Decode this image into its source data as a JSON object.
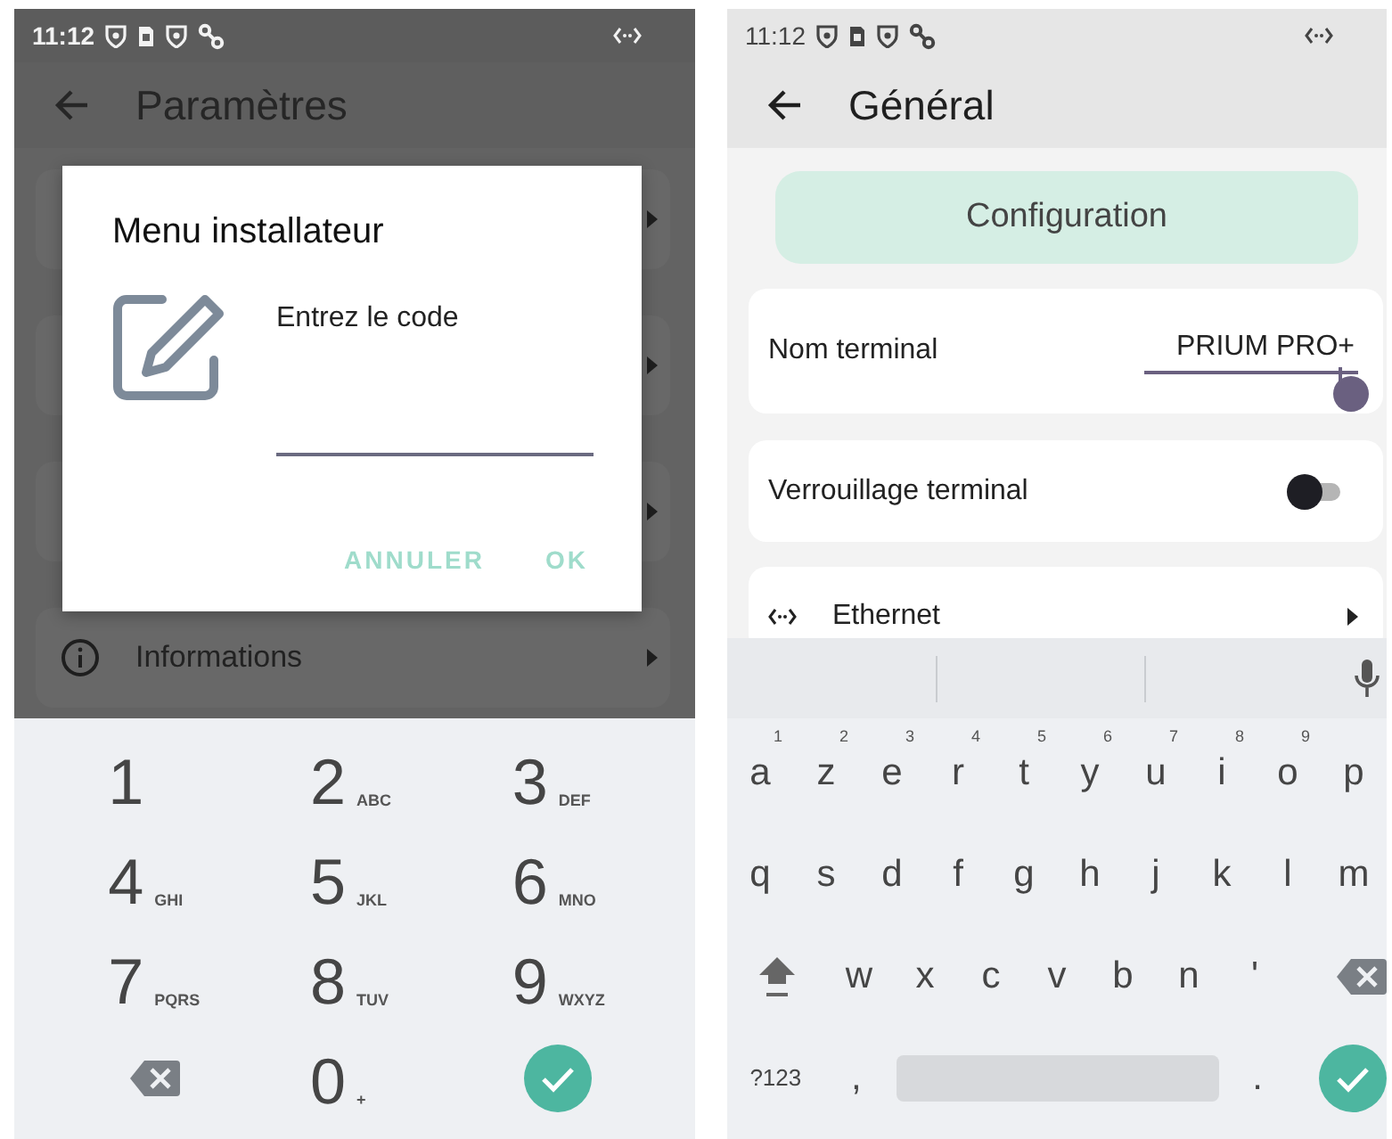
{
  "left_phone": {
    "status_bar": {
      "time": "11:12"
    },
    "app_bar": {
      "title": "Paramètres"
    },
    "list": [
      {
        "kind": "covered"
      },
      {
        "kind": "covered"
      },
      {
        "kind": "covered"
      },
      {
        "kind": "row",
        "label": "Informations"
      }
    ],
    "dialog": {
      "title": "Menu installateur",
      "label": "Entrez le code",
      "buttons": [
        "ANNULER",
        "OK"
      ]
    },
    "keypad": [
      {
        "kind": "digit",
        "digit": "1"
      },
      {
        "kind": "digit",
        "digit": "2",
        "letters": "ABC"
      },
      {
        "kind": "digit",
        "digit": "3",
        "letters": "DEF"
      },
      {
        "kind": "digit",
        "digit": "4",
        "letters": "GHI"
      },
      {
        "kind": "digit",
        "digit": "5",
        "letters": "JKL"
      },
      {
        "kind": "digit",
        "digit": "6",
        "letters": "MNO"
      },
      {
        "kind": "digit",
        "digit": "7",
        "letters": "PQRS"
      },
      {
        "kind": "digit",
        "digit": "8",
        "letters": "TUV"
      },
      {
        "kind": "digit",
        "digit": "9",
        "letters": "WXYZ"
      },
      {
        "kind": "backspace"
      },
      {
        "kind": "digit",
        "digit": "0",
        "letters": "+"
      },
      {
        "kind": "done"
      }
    ]
  },
  "right_phone": {
    "status_bar": {
      "time": "11:12"
    },
    "app_bar": {
      "title": "Général"
    },
    "config_button": "Configuration",
    "settings": [
      {
        "kind": "text",
        "label": "Nom terminal",
        "value": "PRIUM PRO+"
      },
      {
        "kind": "switch",
        "label": "Verrouillage terminal",
        "on": false
      },
      {
        "kind": "link",
        "label": "Ethernet"
      }
    ],
    "keyboard": [
      [
        {
          "kind": "letter",
          "key": "a",
          "hint": "1"
        },
        {
          "kind": "letter",
          "key": "z",
          "hint": "2"
        },
        {
          "kind": "letter",
          "key": "e",
          "hint": "3"
        },
        {
          "kind": "letter",
          "key": "r",
          "hint": "4"
        },
        {
          "kind": "letter",
          "key": "t",
          "hint": "5"
        },
        {
          "kind": "letter",
          "key": "y",
          "hint": "6"
        },
        {
          "kind": "letter",
          "key": "u",
          "hint": "7"
        },
        {
          "kind": "letter",
          "key": "i",
          "hint": "8"
        },
        {
          "kind": "letter",
          "key": "o",
          "hint": "9"
        },
        {
          "kind": "letter",
          "key": "p"
        }
      ],
      [
        {
          "kind": "letter",
          "key": "q"
        },
        {
          "kind": "letter",
          "key": "s"
        },
        {
          "kind": "letter",
          "key": "d"
        },
        {
          "kind": "letter",
          "key": "f"
        },
        {
          "kind": "letter",
          "key": "g"
        },
        {
          "kind": "letter",
          "key": "h"
        },
        {
          "kind": "letter",
          "key": "j"
        },
        {
          "kind": "letter",
          "key": "k"
        },
        {
          "kind": "letter",
          "key": "l"
        },
        {
          "kind": "letter",
          "key": "m"
        }
      ],
      [
        {
          "kind": "shift"
        },
        {
          "kind": "letter",
          "key": "w"
        },
        {
          "kind": "letter",
          "key": "x"
        },
        {
          "kind": "letter",
          "key": "c"
        },
        {
          "kind": "letter",
          "key": "v"
        },
        {
          "kind": "letter",
          "key": "b"
        },
        {
          "kind": "letter",
          "key": "n"
        },
        {
          "kind": "letter",
          "key": "'"
        },
        {
          "kind": "backspace"
        }
      ],
      [
        {
          "kind": "symbols",
          "key": "?123"
        },
        {
          "kind": "letter",
          "key": ","
        },
        {
          "kind": "space"
        },
        {
          "kind": "letter",
          "key": "."
        },
        {
          "kind": "done"
        }
      ]
    ]
  }
}
